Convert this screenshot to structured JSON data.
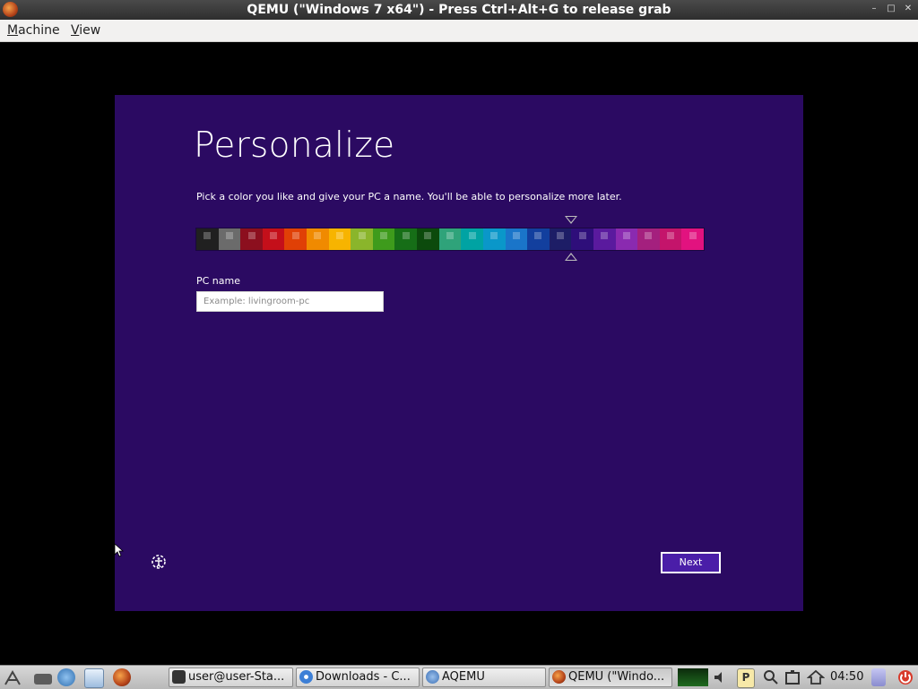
{
  "window": {
    "title": "QEMU (\"Windows 7 x64\") - Press Ctrl+Alt+G to release grab",
    "controls": [
      "–",
      "□",
      "✕"
    ]
  },
  "menu": [
    {
      "label": "Machine",
      "accel": "M",
      "rest": "achine"
    },
    {
      "label": "View",
      "accel": "V",
      "rest": "iew"
    }
  ],
  "setup": {
    "title": "Personalize",
    "subtitle": "Pick a color you like and give your PC a name. You'll be able to personalize more later.",
    "pc_name_label": "PC name",
    "pc_name_placeholder": "Example: livingroom-pc",
    "pc_name_value": "",
    "next_label": "Next",
    "swatches": [
      "#202020",
      "#6b6b6b",
      "#8c0f1e",
      "#c40f1a",
      "#e04006",
      "#f08a00",
      "#f7b400",
      "#8ab52b",
      "#3e9b1c",
      "#166e17",
      "#0c4a0c",
      "#2fa37a",
      "#00a3a3",
      "#0a97c9",
      "#1a75c9",
      "#123f9e",
      "#1d1d66",
      "#2e0e7a",
      "#5a1a9e",
      "#8a2ab0",
      "#a4207e",
      "#c4146b",
      "#e2127f"
    ],
    "selected_index": 17
  },
  "taskbar": {
    "tasks": [
      {
        "label": "user@user-Sta...",
        "icon": "terminal-icon",
        "color": "#333333"
      },
      {
        "label": "Downloads - C...",
        "icon": "chromium-icon",
        "color": "#3d7fd6"
      },
      {
        "label": "AQEMU",
        "icon": "aqemu-icon",
        "color": "#3b6fb5"
      },
      {
        "label": "QEMU (\"Windo...",
        "icon": "qemu-icon",
        "color": "#c4501c"
      }
    ],
    "clock": "04:50"
  }
}
